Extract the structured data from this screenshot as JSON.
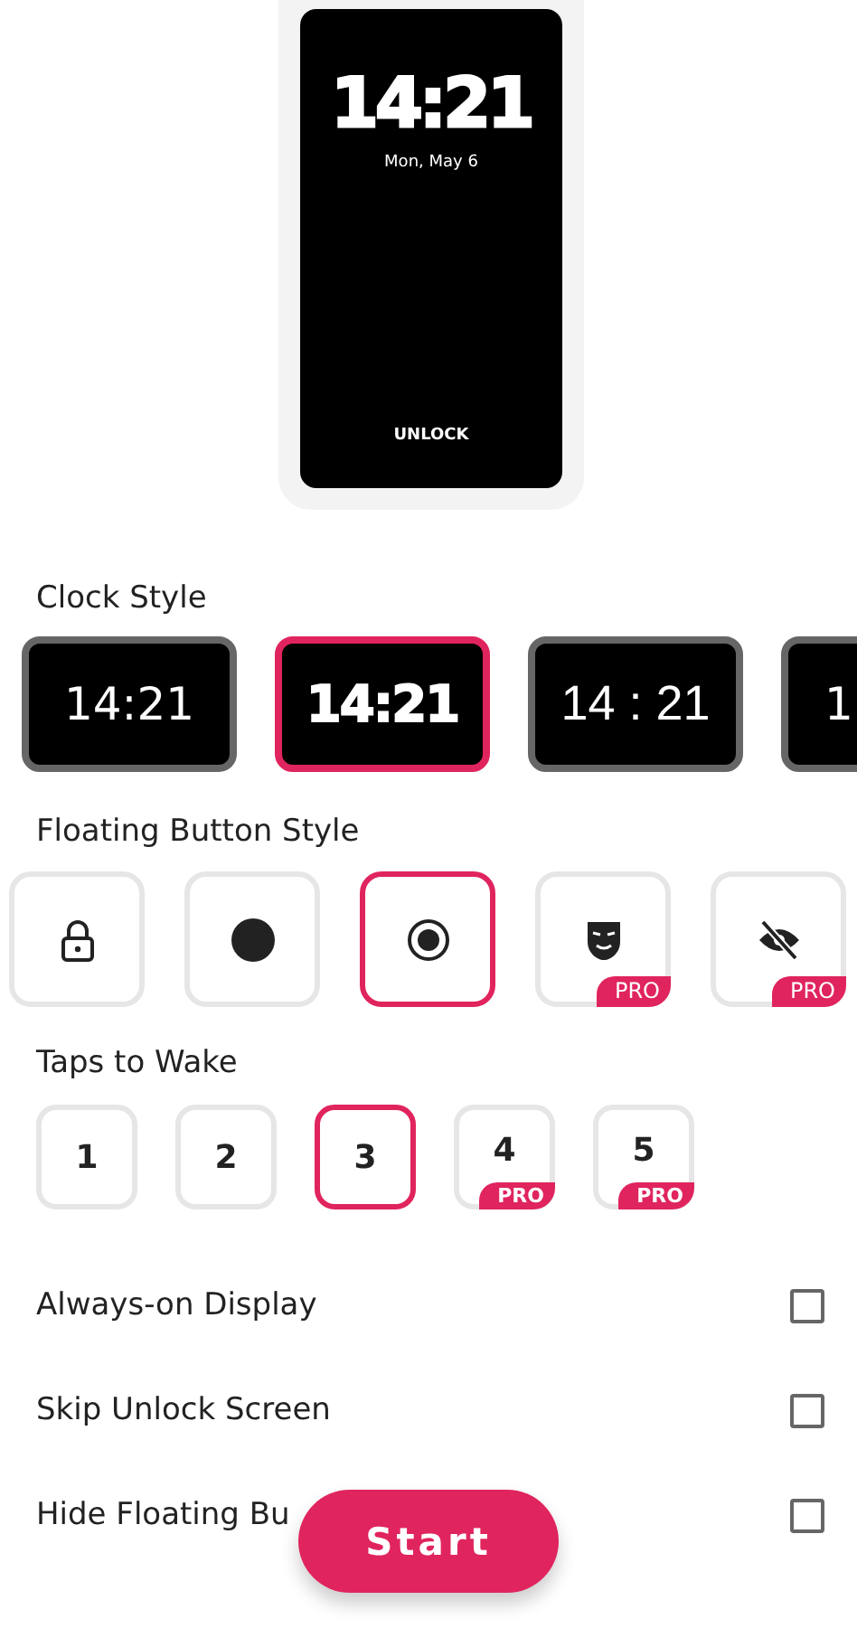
{
  "preview": {
    "time": "14:21",
    "date": "Mon, May 6",
    "unlock": "UNLOCK"
  },
  "clock_style": {
    "title": "Clock Style",
    "items": [
      {
        "time": "14:21",
        "kind": "regular",
        "selected": false
      },
      {
        "time": "14:21",
        "kind": "heavy",
        "selected": true
      },
      {
        "time": "14 : 21",
        "kind": "light",
        "selected": false
      },
      {
        "time": "1",
        "kind": "regular",
        "selected": false
      }
    ]
  },
  "floating_button_style": {
    "title": "Floating Button Style",
    "items": [
      {
        "kind": "lock",
        "selected": false
      },
      {
        "kind": "dot",
        "selected": false
      },
      {
        "kind": "ring",
        "selected": true
      },
      {
        "kind": "mask",
        "selected": false,
        "badge": "PRO"
      },
      {
        "kind": "eye-off",
        "selected": false,
        "badge": "PRO"
      }
    ]
  },
  "taps_to_wake": {
    "title": "Taps to Wake",
    "items": [
      {
        "label": "1",
        "selected": false
      },
      {
        "label": "2",
        "selected": false
      },
      {
        "label": "3",
        "selected": true
      },
      {
        "label": "4",
        "selected": false,
        "badge": "PRO"
      },
      {
        "label": "5",
        "selected": false,
        "badge": "PRO"
      }
    ]
  },
  "options": [
    {
      "label": "Always-on Display",
      "checked": false
    },
    {
      "label": "Skip Unlock Screen",
      "checked": false
    },
    {
      "label": "Hide Floating Bu",
      "checked": false
    }
  ],
  "start_button": "Start"
}
